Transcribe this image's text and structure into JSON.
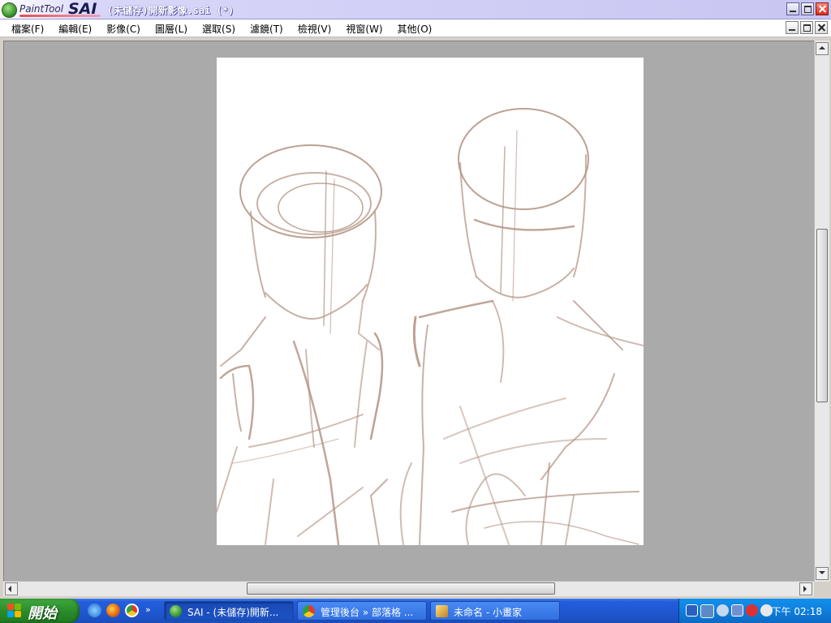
{
  "window": {
    "app_logo_text": "PaintTool",
    "app_logo_brand": "SAI",
    "title": "(未儲存)開新影像.sai (*)"
  },
  "menu": [
    {
      "label": "檔案(F)"
    },
    {
      "label": "編輯(E)"
    },
    {
      "label": "影像(C)"
    },
    {
      "label": "圖層(L)"
    },
    {
      "label": "選取(S)"
    },
    {
      "label": "濾鏡(T)"
    },
    {
      "label": "檢視(V)"
    },
    {
      "label": "視窗(W)"
    },
    {
      "label": "其他(O)"
    }
  ],
  "canvas": {
    "background": "#aaaaaa",
    "paper_color": "#ffffff",
    "stroke_color": "#b09080"
  },
  "taskbar": {
    "start_label": "開始",
    "quicklaunch_icons": [
      "ie-icon",
      "firefox-icon",
      "chrome-icon"
    ],
    "overflow": "»",
    "tasks": [
      {
        "label": "SAI - (未儲存)開新...",
        "icon": "sai-app-icon",
        "active": true
      },
      {
        "label": "管理後台 » 部落格 ...",
        "icon": "chrome-icon",
        "active": false
      },
      {
        "label": "未命名 - 小畫家",
        "icon": "paint-app-icon",
        "active": false
      }
    ],
    "clock": "下午 02:18"
  }
}
